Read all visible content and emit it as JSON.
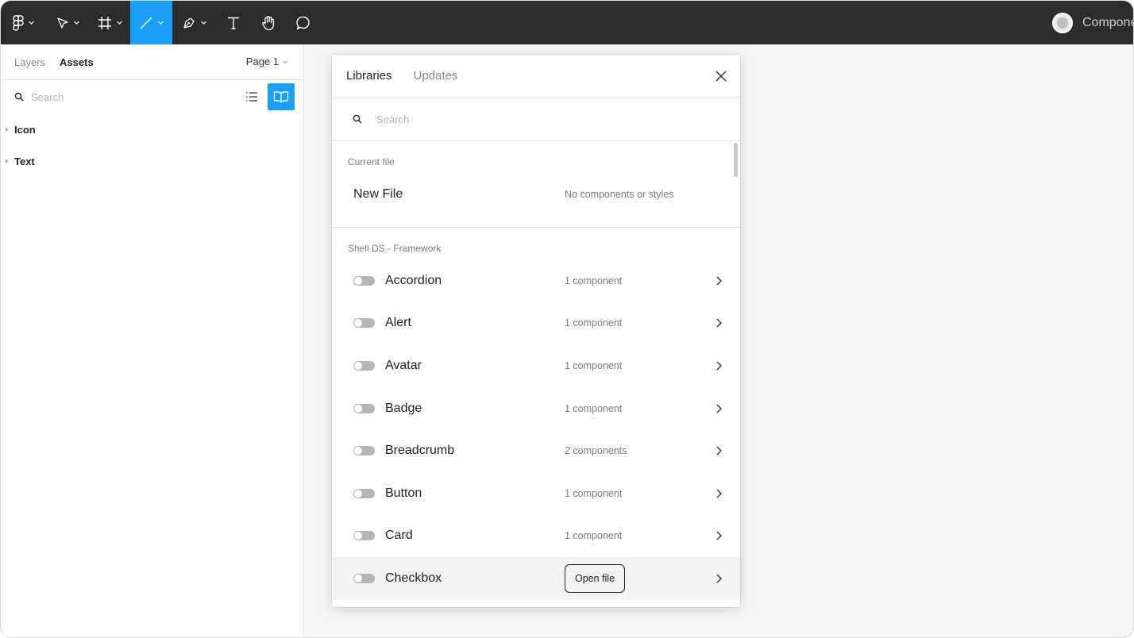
{
  "toolbar": {
    "tools": [
      "figma-menu",
      "move",
      "frame",
      "line",
      "pen",
      "text",
      "hand",
      "comment"
    ],
    "active_tool": "line",
    "file_name": "Components"
  },
  "left_panel": {
    "tabs": [
      "Layers",
      "Assets"
    ],
    "active_tab": "Assets",
    "page_label": "Page 1",
    "search_placeholder": "Search",
    "groups": [
      "Icon",
      "Text"
    ]
  },
  "libraries_modal": {
    "tabs": [
      "Libraries",
      "Updates"
    ],
    "active_tab": "Libraries",
    "search_placeholder": "Search",
    "current_file": {
      "section_title": "Current file",
      "name": "New File",
      "note": "No components or styles"
    },
    "team_section": {
      "title": "Shell DS - Framework",
      "libraries": [
        {
          "name": "Accordion",
          "count": "1 component"
        },
        {
          "name": "Alert",
          "count": "1 component"
        },
        {
          "name": "Avatar",
          "count": "1 component"
        },
        {
          "name": "Badge",
          "count": "1 component"
        },
        {
          "name": "Breadcrumb",
          "count": "2 components"
        },
        {
          "name": "Button",
          "count": "1 component"
        },
        {
          "name": "Card",
          "count": "1 component"
        },
        {
          "name": "Checkbox",
          "count": "",
          "action": "Open file"
        }
      ]
    }
  },
  "colors": {
    "toolbar_bg": "#2c2c2c",
    "accent": "#18a0fb",
    "canvas_bg": "#f5f5f5"
  }
}
